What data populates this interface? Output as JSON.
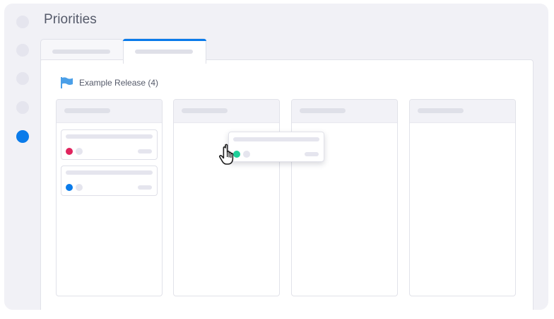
{
  "app": {
    "title": "Priorities"
  },
  "rail": {
    "items": [
      {
        "state": "idle"
      },
      {
        "state": "idle"
      },
      {
        "state": "idle"
      },
      {
        "state": "idle"
      },
      {
        "state": "active"
      }
    ]
  },
  "tabs": [
    {
      "state": "inactive"
    },
    {
      "state": "active"
    }
  ],
  "release": {
    "label": "Example Release (4)",
    "icon": "flag-icon"
  },
  "board": {
    "columns": [
      {
        "cards": [
          {
            "status_color": "#e0245e"
          },
          {
            "status_color": "#0a7bea"
          }
        ]
      },
      {
        "cards": []
      },
      {
        "cards": []
      },
      {
        "cards": []
      }
    ],
    "dragging_card": {
      "status_color": "#1fcf99"
    }
  },
  "colors": {
    "accent": "#0a7bea",
    "red": "#e0245e",
    "blue": "#0a7bea",
    "green": "#1fcf99"
  },
  "cursor": {
    "icon": "hand-pointer-icon"
  }
}
